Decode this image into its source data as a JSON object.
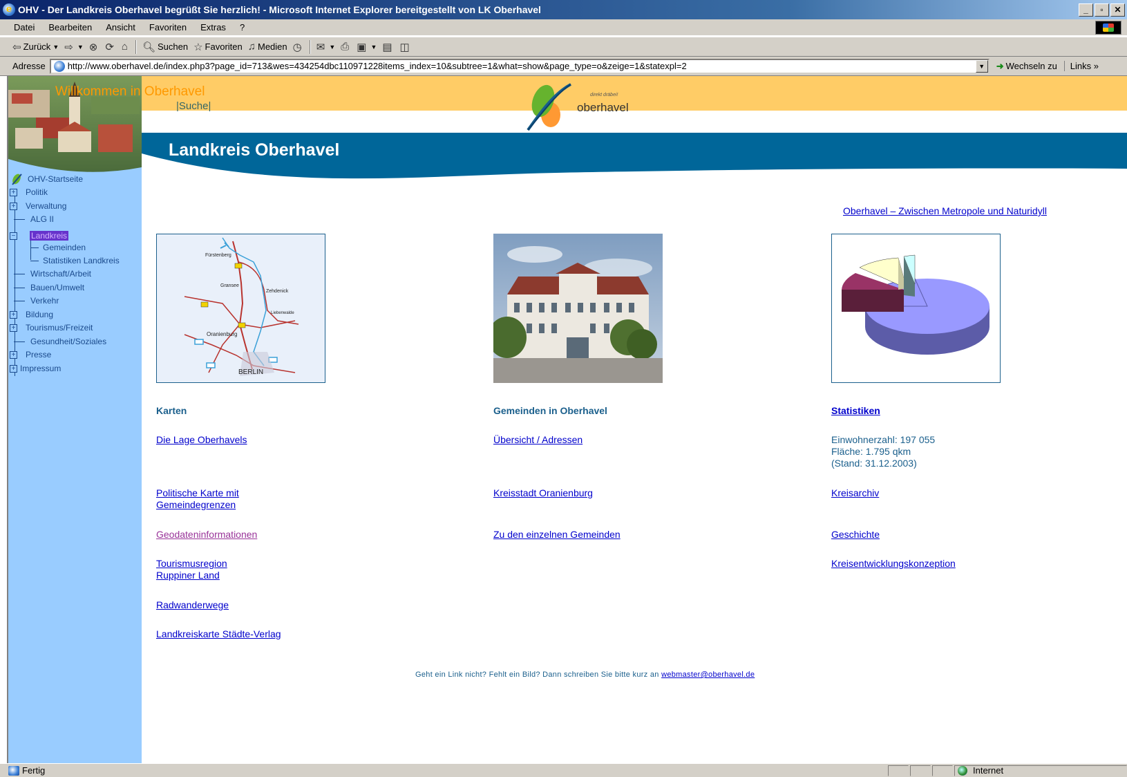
{
  "window": {
    "title": "OHV - Der Landkreis Oberhavel begrüßt Sie herzlich! - Microsoft Internet Explorer bereitgestellt von LK Oberhavel",
    "minimize": "_",
    "maximize": "▫",
    "close": "✕"
  },
  "menu": [
    "Datei",
    "Bearbeiten",
    "Ansicht",
    "Favoriten",
    "Extras",
    "?"
  ],
  "toolbar": {
    "back": "Zurück",
    "search": "Suchen",
    "favorites": "Favoriten",
    "media": "Medien"
  },
  "address": {
    "label": "Adresse",
    "url": "http://www.oberhavel.de/index.php3?page_id=713&wes=434254dbc110971228items_index=10&subtree=1&what=show&page_type=o&zeige=1&statexpl=2",
    "go": "Wechseln zu",
    "links": "Links"
  },
  "status": {
    "text": "Fertig",
    "zone": "Internet"
  },
  "site": {
    "welcome_a": "Willkommen ",
    "welcome_b": "in Oberhavel",
    "search": "Suche",
    "logo_small": "direkt dräbei!",
    "logo_text": "oberhavel",
    "page_title": "Landkreis Oberhavel"
  },
  "nav": {
    "items": [
      {
        "label": "OHV-Startseite"
      },
      {
        "label": "Politik"
      },
      {
        "label": "Verwaltung"
      },
      {
        "label": "ALG II"
      },
      {
        "label": "Landkreis"
      },
      {
        "label": "Gemeinden"
      },
      {
        "label": "Statistiken Landkreis"
      },
      {
        "label": "Wirtschaft/Arbeit"
      },
      {
        "label": "Bauen/Umwelt"
      },
      {
        "label": "Verkehr"
      },
      {
        "label": "Bildung"
      },
      {
        "label": "Tourismus/Freizeit"
      },
      {
        "label": "Gesundheit/Soziales"
      },
      {
        "label": "Presse"
      },
      {
        "label": "Impressum"
      }
    ]
  },
  "content": {
    "top_link": "Oberhavel – Zwischen Metropole und Naturidyll",
    "col1": {
      "heading": "Karten",
      "links": [
        "Die Lage Oberhavels",
        "Politische Karte mit",
        "Gemeindegrenzen",
        "Geodateninformationen",
        "Tourismusregion",
        "Ruppiner Land",
        "Radwanderwege",
        "Landkreiskarte Städte-Verlag"
      ]
    },
    "col2": {
      "heading": "Gemeinden in Oberhavel",
      "links": [
        "Übersicht / Adressen",
        "Kreisstadt Oranienburg",
        "Zu den einzelnen Gemeinden"
      ]
    },
    "col3": {
      "heading": "Statistiken",
      "stats": [
        "Einwohnerzahl: 197 055",
        "Fläche: 1.795 qkm",
        "(Stand: 31.12.2003)"
      ],
      "links": [
        "Kreisarchiv",
        "Geschichte",
        "Kreisentwicklungskonzeption"
      ]
    },
    "map_labels": [
      "Fürstenberg",
      "Gransee",
      "Zehdenick",
      "Liebenwalde",
      "Oranienburg",
      "BERLIN"
    ],
    "footer_text": "Geht ein Link nicht? Fehlt ein Bild? Dann schreiben Sie bitte kurz an ",
    "footer_email": "webmaster@oberhavel.de"
  },
  "colors": {
    "sidebar": "#99ccff",
    "header_yellow": "#ffcc66",
    "band_blue": "#006699",
    "heading": "#1a5f8c",
    "link": "#0000cc",
    "visited": "#993399"
  }
}
